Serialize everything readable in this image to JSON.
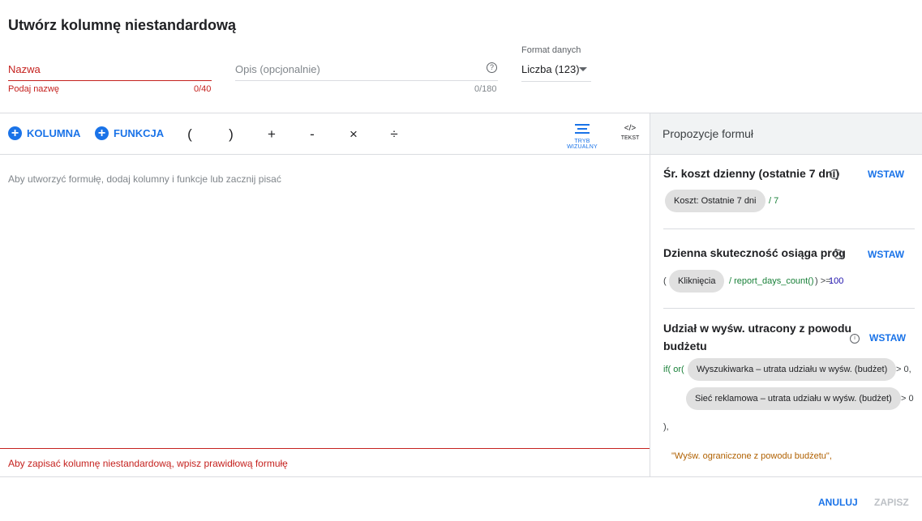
{
  "dialog": {
    "title": "Utwórz kolumnę niestandardową"
  },
  "name_field": {
    "label": "Nazwa",
    "hint": "Podaj nazwę",
    "counter": "0/40"
  },
  "description_field": {
    "placeholder": "Opis (opcjonalnie)",
    "counter": "0/180",
    "help_icon": "help-circle-icon"
  },
  "format": {
    "label": "Format danych",
    "value": "Liczba (123)"
  },
  "toolbar": {
    "column_label": "KOLUMNA",
    "function_label": "FUNKCJA",
    "operators": [
      "(",
      ")",
      "+",
      "-",
      "×",
      "÷"
    ],
    "visual_mode_label": "TRYB WIZUALNY",
    "text_mode_label": "TEKST",
    "text_mode_glyph": "</>"
  },
  "editor": {
    "placeholder": "Aby utworzyć formułę, dodaj kolumny i funkcje lub zacznij pisać",
    "error": "Aby zapisać kolumnę niestandardową, wpisz prawidłową formułę"
  },
  "suggestions": {
    "header": "Propozycje formuł",
    "insert_label": "WSTAW",
    "cards": [
      {
        "title": "Śr. koszt dzienny (ostatnie 7 dni)",
        "chip": "Koszt: Ostatnie 7 dni",
        "after": "/ 7"
      },
      {
        "title": "Dzienna skuteczność osiąga próg",
        "open": "(",
        "chip": "Kliknięcia",
        "mid": "/ report_days_count()",
        "op": ") >=",
        "num": "100"
      },
      {
        "title_line1": "Udział w wyśw. utracony z powodu",
        "title_line2": "budżetu",
        "prefix": "if( or(",
        "chip1": "Wyszukiwarka – utrata udziału w wyśw. (budżet)",
        "after1": "> 0,",
        "chip2": "Sieć reklamowa – utrata udziału w wyśw. (budżet)",
        "after2": "> 0",
        "close": "),",
        "string": "\"Wyśw. ograniczone z powodu budżetu\","
      }
    ]
  },
  "footer": {
    "cancel": "ANULUJ",
    "save": "ZAPISZ"
  },
  "colors": {
    "accent": "#1a73e8",
    "error": "#c5221f",
    "disabled": "#bdc1c6"
  }
}
